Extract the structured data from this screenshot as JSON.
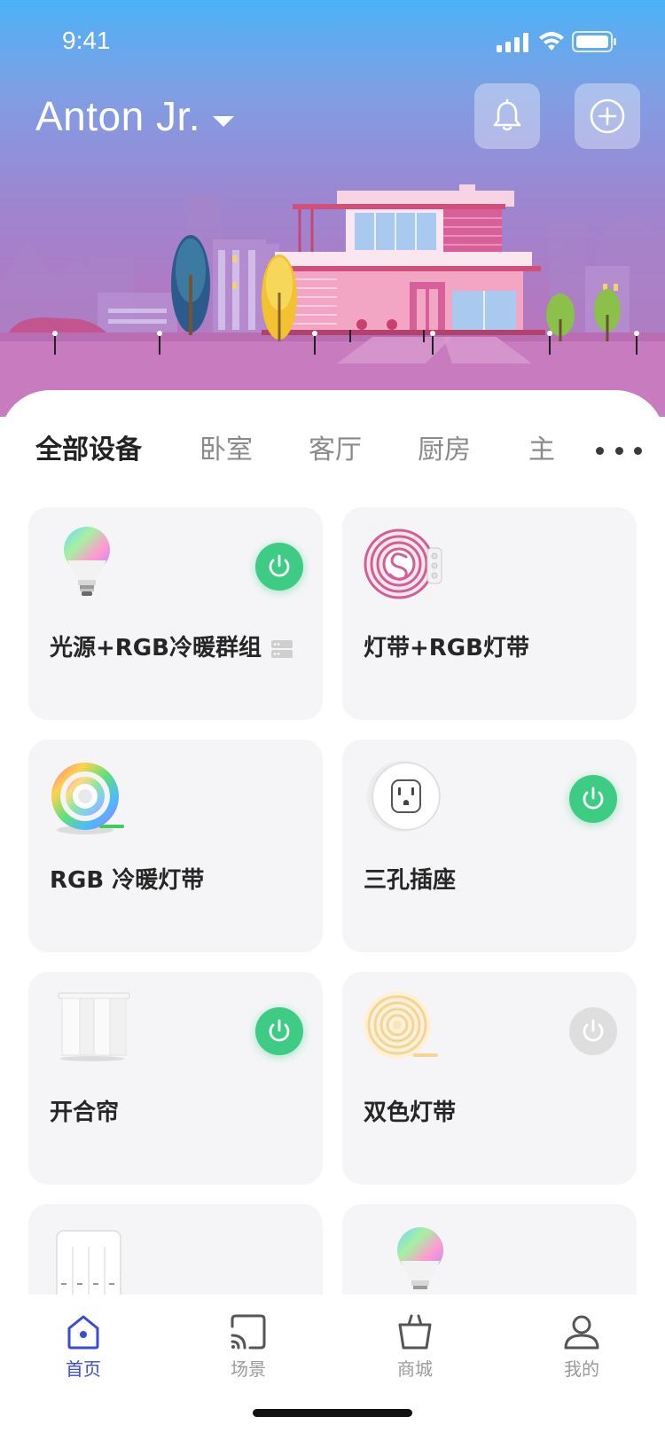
{
  "status_bar": {
    "time": "9:41"
  },
  "header": {
    "user_name": "Anton Jr.",
    "notifications_icon": "bell-icon",
    "add_icon": "plus-circle-icon"
  },
  "tabs": [
    {
      "label": "全部设备",
      "active": true
    },
    {
      "label": "卧室",
      "active": false
    },
    {
      "label": "客厅",
      "active": false
    },
    {
      "label": "厨房",
      "active": false
    },
    {
      "label": "主",
      "active": false
    }
  ],
  "devices": [
    {
      "name": "光源+RGB冷暖群组",
      "icon": "rgb-bulb-icon",
      "power": "on",
      "group": true
    },
    {
      "name": "灯带+RGB灯带",
      "icon": "pink-light-strip-icon",
      "power": null
    },
    {
      "name": "RGB 冷暖灯带",
      "icon": "rgb-light-strip-icon",
      "power": null
    },
    {
      "name": "三孔插座",
      "icon": "socket-icon",
      "power": "on"
    },
    {
      "name": "开合帘",
      "icon": "curtain-icon",
      "power": "on"
    },
    {
      "name": "双色灯带",
      "icon": "warm-light-strip-icon",
      "power": "off"
    },
    {
      "name": "",
      "icon": "wall-switch-icon",
      "power": null
    },
    {
      "name": "",
      "icon": "rgb-bulb-icon",
      "power": null
    }
  ],
  "nav": [
    {
      "label": "首页",
      "icon": "home-icon",
      "active": true
    },
    {
      "label": "场景",
      "icon": "cast-icon",
      "active": false
    },
    {
      "label": "商城",
      "icon": "shopping-bag-icon",
      "active": false
    },
    {
      "label": "我的",
      "icon": "user-icon",
      "active": false
    }
  ],
  "colors": {
    "accent": "#3b4bd6",
    "power_on": "#3ecc84",
    "power_off": "#dedede",
    "card_bg": "#f5f5f7"
  }
}
